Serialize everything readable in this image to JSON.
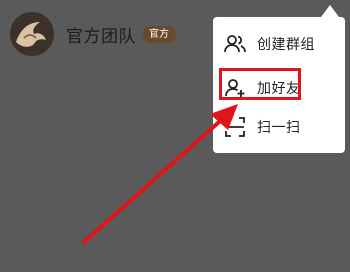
{
  "group": {
    "name": "官方团队",
    "badge": "官方"
  },
  "menu": {
    "items": [
      {
        "label": "创建群组",
        "icon": "group-icon"
      },
      {
        "label": "加好友",
        "icon": "add-friend-icon"
      },
      {
        "label": "扫一扫",
        "icon": "scan-icon"
      }
    ]
  },
  "annotation": {
    "highlight_color": "#e0141b",
    "highlighted_item": "加好友"
  }
}
